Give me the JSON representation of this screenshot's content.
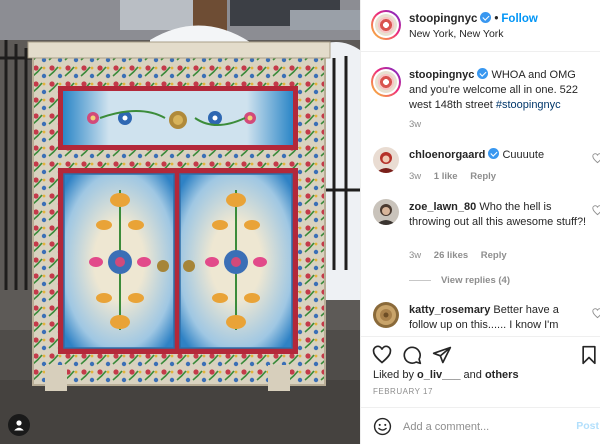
{
  "post": {
    "username": "stoopingnyc",
    "follow_label": "Follow",
    "location": "New York, New York",
    "caption": "WHOA and OMG and you're welcome all in one. 522 west 148th street",
    "hashtag": "#stoopingnyc",
    "caption_age": "3w"
  },
  "comments": [
    {
      "username": "chloenorgaard",
      "verified": true,
      "text": "Cuuuute",
      "age": "3w",
      "likes": "1 like",
      "reply_label": "Reply"
    },
    {
      "username": "zoe_lawn_80",
      "verified": false,
      "text": "Who the hell is throwing out all this awesome stuff?!",
      "age": "3w",
      "likes": "26 likes",
      "reply_label": "Reply",
      "view_replies": "View replies (4)"
    },
    {
      "username": "katty_rosemary",
      "verified": false,
      "text": "Better have a follow up on this...... I know I'm"
    }
  ],
  "engagement": {
    "liked_prefix": "Liked by",
    "liked_user": "o_liv___",
    "liked_and": "and",
    "liked_others": "others",
    "date": "February 17"
  },
  "comment_box": {
    "placeholder": "Add a comment...",
    "post_label": "Post"
  },
  "icons": {
    "like": "heart-icon",
    "comment": "comment-icon",
    "share": "paper-plane-icon",
    "save": "bookmark-icon",
    "emoji": "smiley-icon",
    "tagged_user": "user-icon"
  },
  "colors": {
    "link": "#0095f6",
    "hashtag": "#00376b",
    "muted": "#8e8e8e",
    "verified": "#3897f0",
    "post_disabled": "#b2dffc"
  }
}
